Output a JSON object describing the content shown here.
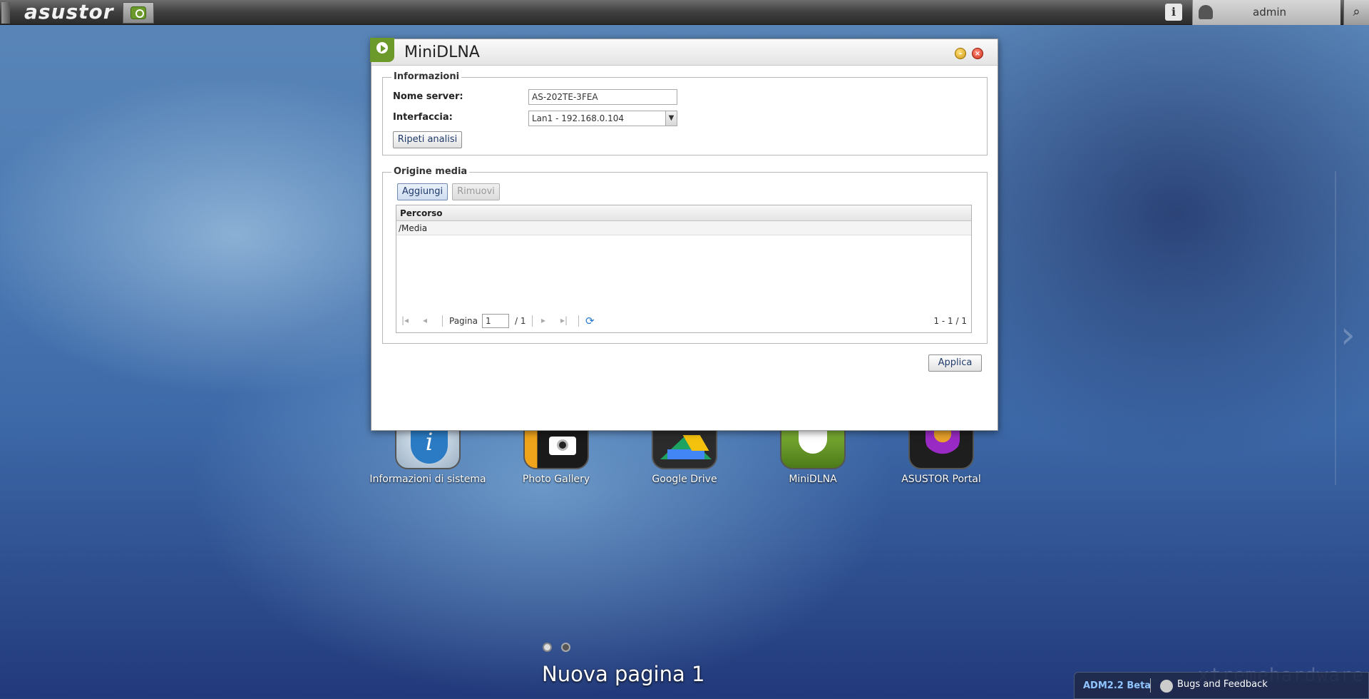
{
  "topbar": {
    "logo": "asustor",
    "user": "admin",
    "info_icon": "i",
    "search_icon": "⌕"
  },
  "window": {
    "title": "MiniDLNA",
    "info_section": {
      "legend": "Informazioni",
      "server_name_label": "Nome server:",
      "server_name_value": "AS-202TE-3FEA",
      "interface_label": "Interfaccia:",
      "interface_value": "Lan1 - 192.168.0.104",
      "rescan_button": "Ripeti analisi"
    },
    "media_section": {
      "legend": "Origine media",
      "add_button": "Aggiungi",
      "remove_button": "Rimuovi",
      "column_header": "Percorso",
      "rows": [
        "/Media"
      ],
      "pager": {
        "page_label": "Pagina",
        "page_value": "1",
        "page_total": "/ 1",
        "count": "1 - 1 / 1"
      }
    },
    "apply_button": "Applica"
  },
  "desktop": {
    "icons": [
      {
        "label": "Informazioni di sistema",
        "icon": "info-icon",
        "color": "#2a7bc4"
      },
      {
        "label": "Photo Gallery",
        "icon": "camera-icon",
        "color": "#f0a41c"
      },
      {
        "label": "Google Drive",
        "icon": "google-drive-icon",
        "color": "#2b2b2b"
      },
      {
        "label": "MiniDLNA",
        "icon": "minidlna-icon",
        "color": "#6b9a2b"
      },
      {
        "label": "ASUSTOR Portal",
        "icon": "portal-icon",
        "color": "#6a2a9a"
      }
    ],
    "page_title": "Nuova pagina 1"
  },
  "bottom_bar": {
    "version": "ADM2.2 Beta",
    "feedback": "Bugs and Feedback",
    "watermark": "xtremehardware.com"
  }
}
